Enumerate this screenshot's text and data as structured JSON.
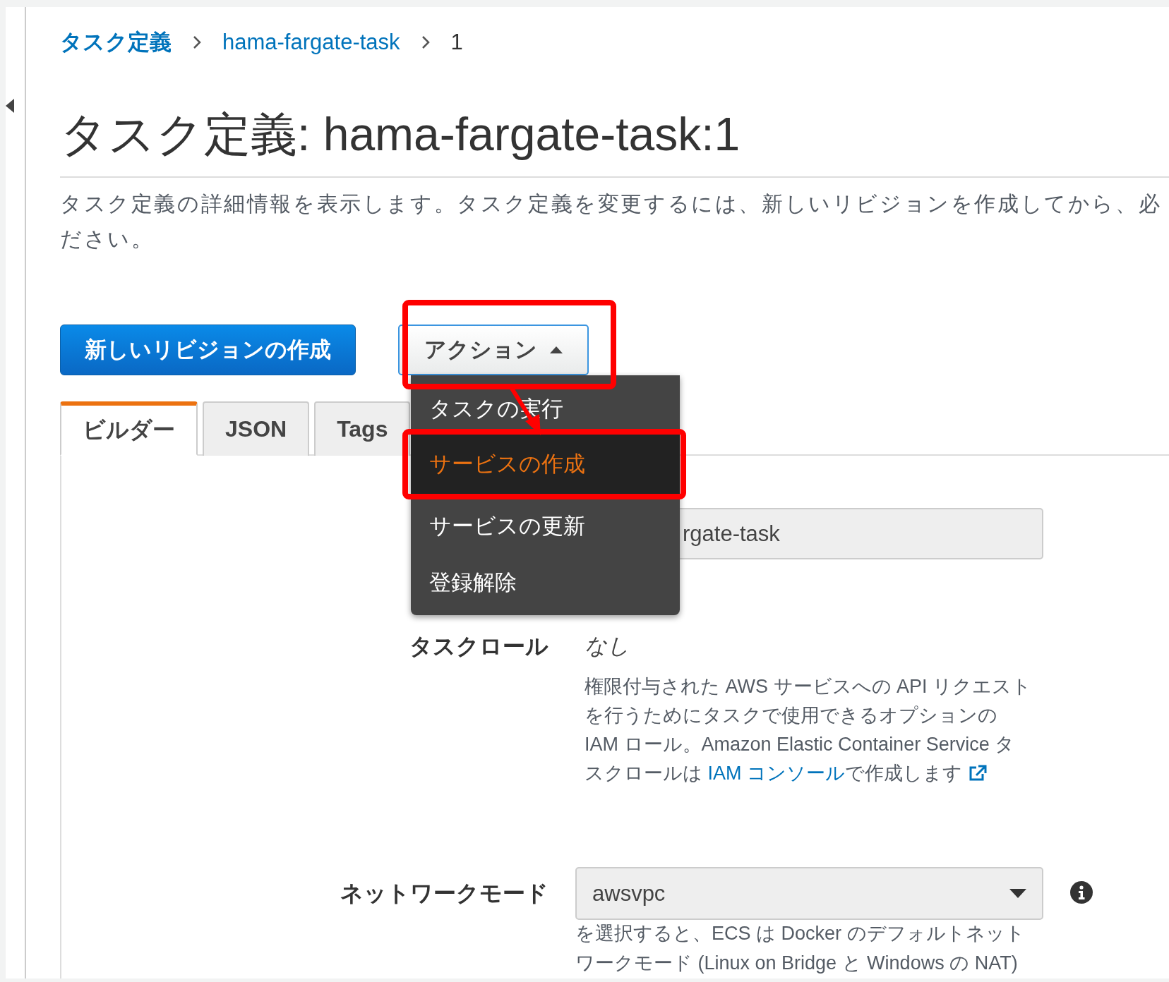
{
  "breadcrumb": [
    {
      "label": "タスク定義",
      "kind": "link"
    },
    {
      "label": "hama-fargate-task",
      "kind": "link"
    },
    {
      "label": "1",
      "kind": "current"
    }
  ],
  "title": "タスク定義: hama-fargate-task:1",
  "description": [
    "タスク定義の詳細情報を表示します。タスク定義を変更するには、新しいリビジョンを作成してから、必",
    "ださい。"
  ],
  "primary_button": "新しいリビジョンの作成",
  "actions_button": {
    "label": "アクション",
    "expanded": true
  },
  "actions_menu": [
    {
      "label": "タスクの実行",
      "selected": false
    },
    {
      "label": "サービスの作成",
      "selected": true
    },
    {
      "label": "サービスの更新",
      "selected": false
    },
    {
      "label": "登録解除",
      "selected": false
    }
  ],
  "tabs": [
    {
      "label": "ビルダー",
      "selected": true
    },
    {
      "label": "JSON",
      "selected": false
    },
    {
      "label": "Tags",
      "selected": false
    }
  ],
  "fields": [
    {
      "kind": "text",
      "value": "rgate-task"
    },
    {
      "kind": "static",
      "label": "タスクロール",
      "value": "なし",
      "help": [
        {
          "text": "権限付与された AWS サービスへの API リクエストを行うためにタスクで使用できるオプションの IAM ロール。Amazon Elastic Container Service タスクロールは "
        },
        {
          "link": "IAM コンソール"
        },
        {
          "text": "で作成します"
        }
      ],
      "external": true
    },
    {
      "kind": "select",
      "label": "ネットワークモード",
      "value": "awsvpc",
      "info": true,
      "help": [
        {
          "text": "を選択すると、ECS は Docker のデフォルトネットワークモード (Linux on Bridge と Windows の NAT)"
        }
      ]
    }
  ],
  "annotations": [
    {
      "kind": "box"
    },
    {
      "kind": "arrow"
    },
    {
      "kind": "box"
    }
  ]
}
